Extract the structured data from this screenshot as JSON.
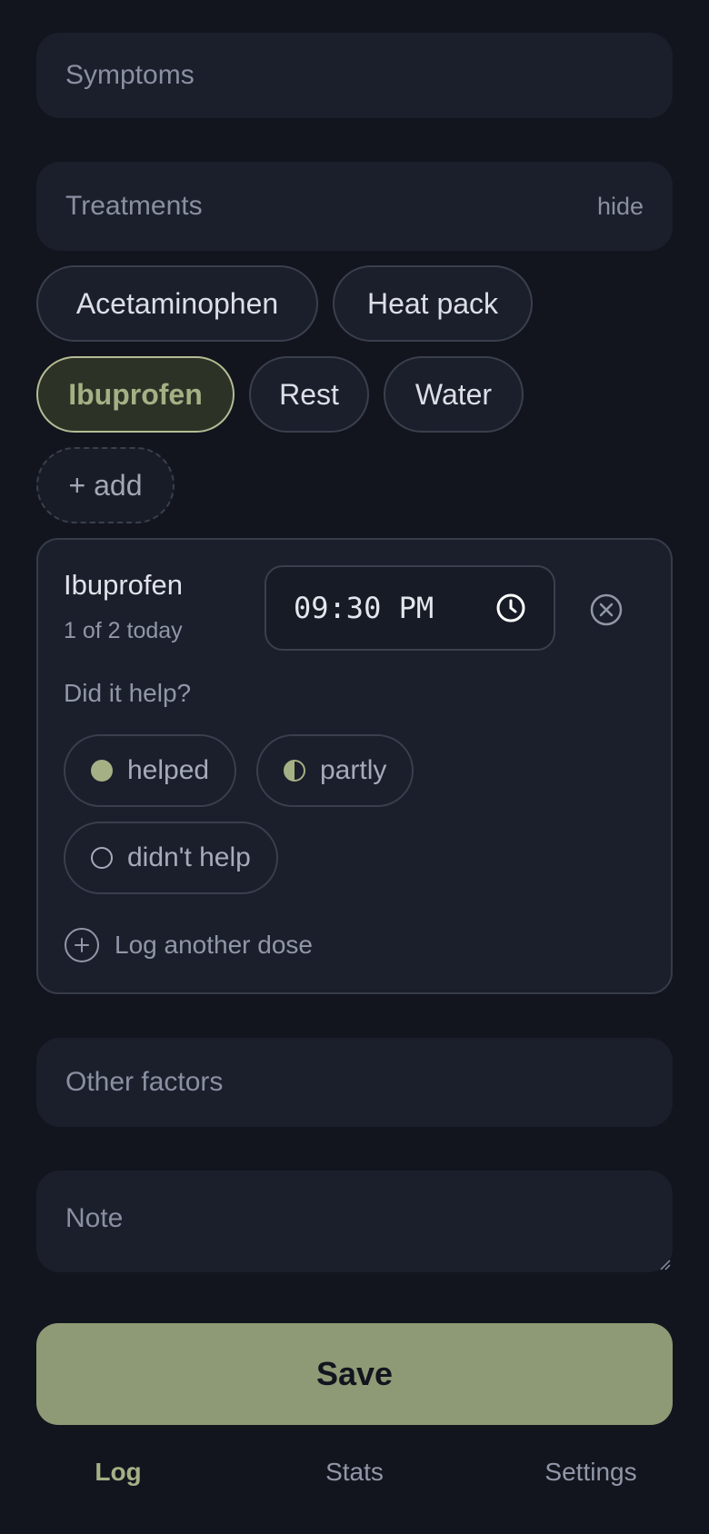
{
  "fields": {
    "symptoms_label": "Symptoms",
    "treatments_label": "Treatments",
    "treatments_toggle": "hide",
    "other_factors_label": "Other factors",
    "note_placeholder": "Note"
  },
  "treatment_chips": [
    {
      "label": "Acetaminophen",
      "selected": false
    },
    {
      "label": "Heat pack",
      "selected": false
    },
    {
      "label": "Ibuprofen",
      "selected": true
    },
    {
      "label": "Rest",
      "selected": false
    },
    {
      "label": "Water",
      "selected": false
    }
  ],
  "add_chip_label": "+ add",
  "dose_card": {
    "name": "Ibuprofen",
    "subtitle": "1 of 2 today",
    "time": "09:30 PM",
    "question": "Did it help?",
    "options": [
      {
        "label": "helped",
        "icon": "filled-circle-icon"
      },
      {
        "label": "partly",
        "icon": "half-circle-icon"
      },
      {
        "label": "didn't help",
        "icon": "empty-circle-icon"
      }
    ],
    "add_dose_label": "Log another dose"
  },
  "save_label": "Save",
  "nav": {
    "log": "Log",
    "stats": "Stats",
    "settings": "Settings",
    "active": "Log"
  },
  "colors": {
    "background": "#12151e",
    "surface": "#1b1f2b",
    "accent": "#a5b085",
    "save_button": "#8e9a75"
  }
}
